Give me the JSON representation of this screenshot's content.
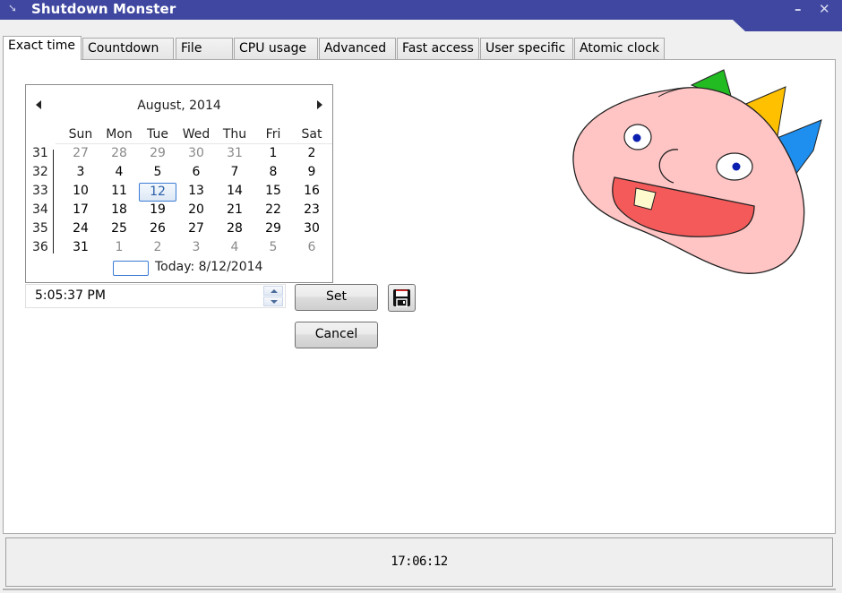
{
  "window": {
    "title": "Shutdown Monster",
    "minimize_label": "–",
    "close_label": "✕",
    "app_icon": "pin-icon"
  },
  "tabs": [
    {
      "label": "Exact time",
      "active": true
    },
    {
      "label": "Countdown",
      "active": false
    },
    {
      "label": "File",
      "active": false
    },
    {
      "label": "CPU usage",
      "active": false
    },
    {
      "label": "Advanced",
      "active": false
    },
    {
      "label": "Fast access",
      "active": false
    },
    {
      "label": "User specific",
      "active": false
    },
    {
      "label": "Atomic clock",
      "active": false
    }
  ],
  "calendar": {
    "month_title": "August, 2014",
    "prev_icon": "triangle-left-icon",
    "next_icon": "triangle-right-icon",
    "weekdays": [
      "Sun",
      "Mon",
      "Tue",
      "Wed",
      "Thu",
      "Fri",
      "Sat"
    ],
    "weeks": [
      {
        "week": "31",
        "days": [
          {
            "d": "27",
            "other": true
          },
          {
            "d": "28",
            "other": true
          },
          {
            "d": "29",
            "other": true
          },
          {
            "d": "30",
            "other": true
          },
          {
            "d": "31",
            "other": true
          },
          {
            "d": "1"
          },
          {
            "d": "2"
          }
        ]
      },
      {
        "week": "32",
        "days": [
          {
            "d": "3"
          },
          {
            "d": "4"
          },
          {
            "d": "5"
          },
          {
            "d": "6"
          },
          {
            "d": "7"
          },
          {
            "d": "8"
          },
          {
            "d": "9"
          }
        ]
      },
      {
        "week": "33",
        "days": [
          {
            "d": "10"
          },
          {
            "d": "11"
          },
          {
            "d": "12",
            "selected": true
          },
          {
            "d": "13"
          },
          {
            "d": "14"
          },
          {
            "d": "15"
          },
          {
            "d": "16"
          }
        ]
      },
      {
        "week": "34",
        "days": [
          {
            "d": "17"
          },
          {
            "d": "18"
          },
          {
            "d": "19"
          },
          {
            "d": "20"
          },
          {
            "d": "21"
          },
          {
            "d": "22"
          },
          {
            "d": "23"
          }
        ]
      },
      {
        "week": "35",
        "days": [
          {
            "d": "24"
          },
          {
            "d": "25"
          },
          {
            "d": "26"
          },
          {
            "d": "27"
          },
          {
            "d": "28"
          },
          {
            "d": "29"
          },
          {
            "d": "30"
          }
        ]
      },
      {
        "week": "36",
        "days": [
          {
            "d": "31"
          },
          {
            "d": "1",
            "other": true
          },
          {
            "d": "2",
            "other": true
          },
          {
            "d": "3",
            "other": true
          },
          {
            "d": "4",
            "other": true
          },
          {
            "d": "5",
            "other": true
          },
          {
            "d": "6",
            "other": true
          }
        ]
      }
    ],
    "selected_day": "12",
    "today_label": "Today: 8/12/2014"
  },
  "time_field": {
    "value": "5:05:37 PM"
  },
  "buttons": {
    "set_label": "Set",
    "cancel_label": "Cancel",
    "save_icon": "floppy-disk-icon"
  },
  "statusbar": {
    "clock": "17:06:12"
  },
  "colors": {
    "titlebar": "#3f47a0",
    "selection": "#3a7bd5",
    "monster_face": "#ffc4c4",
    "monster_mouth": "#f55a5a",
    "spike_green": "#22bb22",
    "spike_yellow": "#ffc000",
    "spike_blue": "#1e8fef"
  }
}
